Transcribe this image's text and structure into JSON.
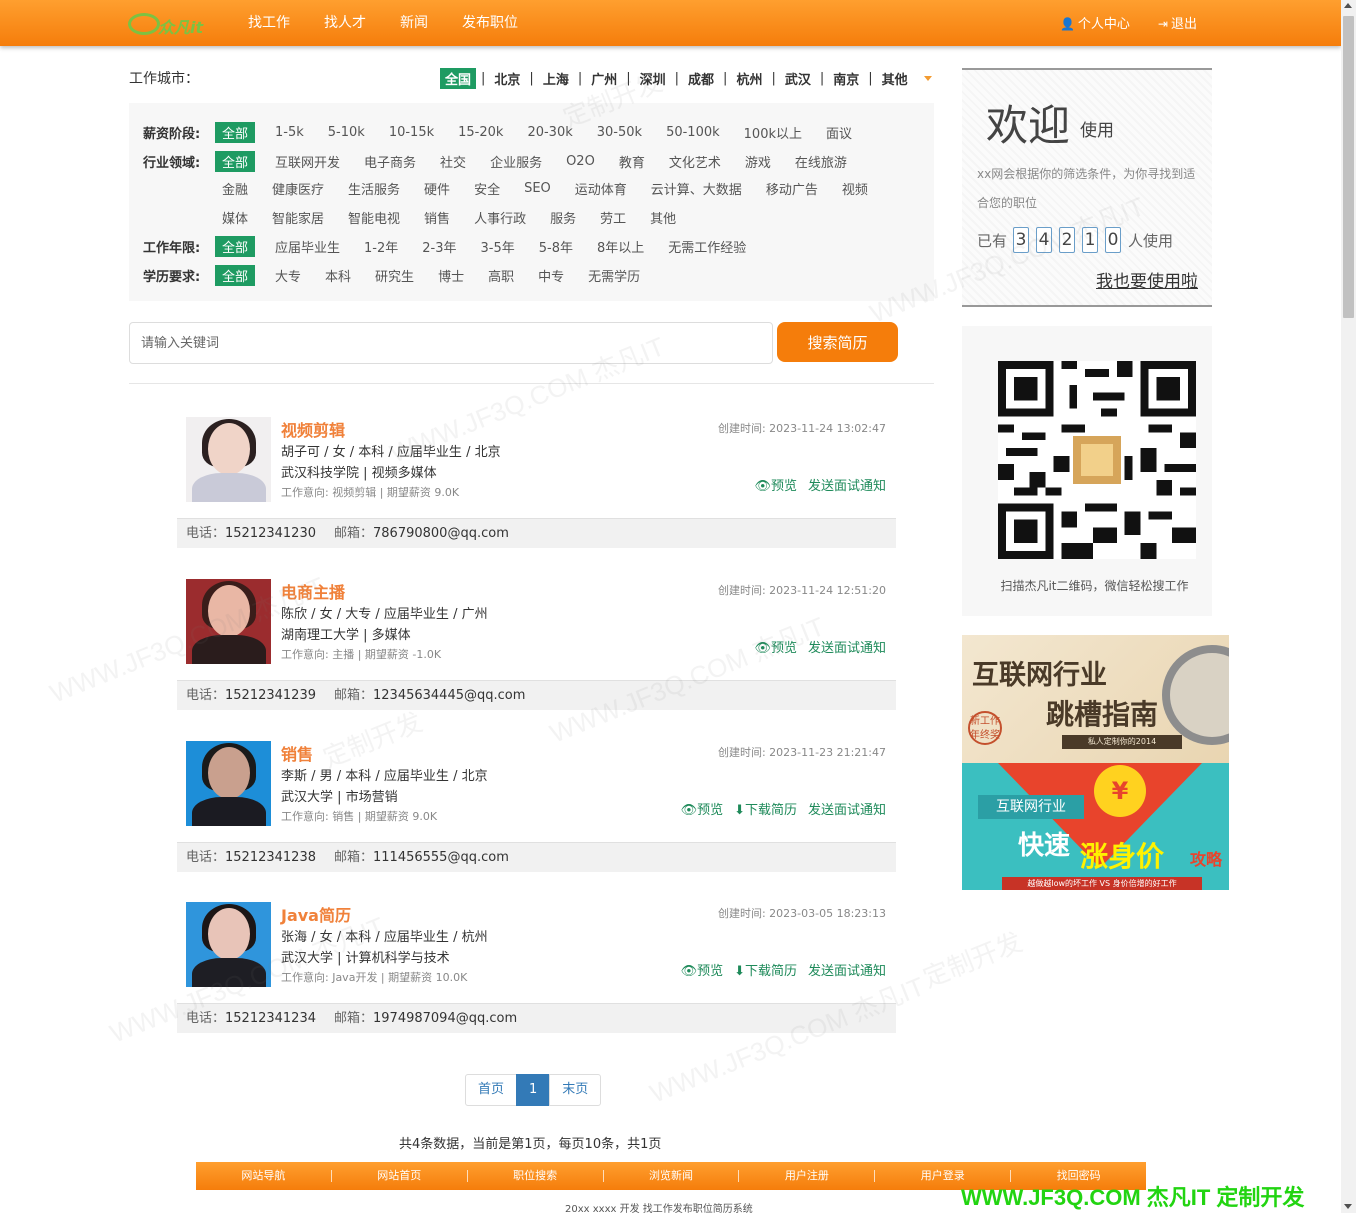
{
  "header": {
    "logo_text": "众凡it",
    "nav": [
      "找工作",
      "找人才",
      "新闻",
      "发布职位"
    ],
    "user_center": "个人中心",
    "logout": "退出"
  },
  "city": {
    "label": "工作城市：",
    "items": [
      "全国",
      "北京",
      "上海",
      "广州",
      "深圳",
      "成都",
      "杭州",
      "武汉",
      "南京",
      "其他"
    ],
    "selected": "全国"
  },
  "filters": {
    "salary": {
      "label": "薪资阶段:",
      "options": [
        "全部",
        "1-5k",
        "5-10k",
        "10-15k",
        "15-20k",
        "20-30k",
        "30-50k",
        "50-100k",
        "100k以上",
        "面议"
      ]
    },
    "industry": {
      "label": "行业领域:",
      "row1": [
        "全部",
        "互联网开发",
        "电子商务",
        "社交",
        "企业服务",
        "O2O",
        "教育",
        "文化艺术",
        "游戏",
        "在线旅游"
      ],
      "row2": [
        "金融",
        "健康医疗",
        "生活服务",
        "硬件",
        "安全",
        "SEO",
        "运动体育",
        "云计算、大数据",
        "移动广告",
        "视频"
      ],
      "row3": [
        "媒体",
        "智能家居",
        "智能电视",
        "销售",
        "人事行政",
        "服务",
        "劳工",
        "其他"
      ]
    },
    "experience": {
      "label": "工作年限:",
      "options": [
        "全部",
        "应届毕业生",
        "1-2年",
        "2-3年",
        "3-5年",
        "5-8年",
        "8年以上",
        "无需工作经验"
      ]
    },
    "education": {
      "label": "学历要求:",
      "options": [
        "全部",
        "大专",
        "本科",
        "研究生",
        "博士",
        "高职",
        "中专",
        "无需学历"
      ]
    }
  },
  "search": {
    "placeholder": "请输入关键词",
    "button": "搜索简历"
  },
  "resumes": [
    {
      "title": "视频剪辑",
      "meta": "胡子可 / 女 / 本科 / 应届毕业生 / 北京",
      "school": "武汉科技学院 | 视频多媒体",
      "intent": "工作意向:   视频剪辑 | 期望薪资 9.0K",
      "created": "创建时间:  2023-11-24 13:02:47",
      "phone_label": "电话：",
      "phone": "15212341230",
      "email_label": "邮箱：",
      "email": "786790800@qq.com",
      "actions": [
        "👁预览",
        "发送面试通知"
      ]
    },
    {
      "title": "电商主播",
      "meta": "陈欣 / 女 / 大专 / 应届毕业生 / 广州",
      "school": "湖南理工大学 | 多媒体",
      "intent": "工作意向:   主播 | 期望薪资 -1.0K",
      "created": "创建时间:  2023-11-24 12:51:20",
      "phone_label": "电话：",
      "phone": "15212341239",
      "email_label": "邮箱：",
      "email": "12345634445@qq.com",
      "actions": [
        "👁预览",
        "发送面试通知"
      ]
    },
    {
      "title": "销售",
      "meta": "李斯 / 男 / 本科 / 应届毕业生 / 北京",
      "school": "武汉大学 | 市场营销",
      "intent": "工作意向:   销售 | 期望薪资 9.0K",
      "created": "创建时间:  2023-11-23 21:21:47",
      "phone_label": "电话：",
      "phone": "15212341238",
      "email_label": "邮箱：",
      "email": "111456555@qq.com",
      "actions": [
        "👁预览",
        "⬇下载简历",
        "发送面试通知"
      ]
    },
    {
      "title": "Java简历",
      "meta": "张海 / 女 / 本科 / 应届毕业生 / 杭州",
      "school": "武汉大学 | 计算机科学与技术",
      "intent": "工作意向:   Java开发 | 期望薪资 10.0K",
      "created": "创建时间:  2023-03-05 18:23:13",
      "phone_label": "电话：",
      "phone": "15212341234",
      "email_label": "邮箱：",
      "email": "1974987094@qq.com",
      "actions": [
        "👁预览",
        "⬇下载简历",
        "发送面试通知"
      ]
    }
  ],
  "pager": {
    "first": "首页",
    "current": "1",
    "last": "末页",
    "info": "共4条数据，当前是第1页，每页10条，共1页"
  },
  "footer": {
    "links": [
      "网站导航",
      "网站首页",
      "职位搜索",
      "浏览新闻",
      "用户注册",
      "用户登录",
      "找回密码"
    ],
    "copyright": "20xx  xxxx  开发  找工作发布职位简历系统",
    "brand": "WWW.JF3Q.COM 杰凡IT  定制开发"
  },
  "sidebar": {
    "welcome_big": "欢迎",
    "welcome_small": "使用",
    "desc": "xx网会根据你的筛选条件，为你寻找到适合您的职位",
    "count_prefix": "已有",
    "digits": [
      "3",
      "4",
      "2",
      "1",
      "0"
    ],
    "count_suffix": "人使用",
    "cta": "我也要使用啦",
    "qr_caption": "扫描杰凡it二维码，微信轻松搜工作",
    "ad1": {
      "line1": "互联网行业",
      "line2": "跳槽指南",
      "seal": "新工作 年终奖",
      "ribbon": "私人定制你的2014"
    },
    "ad2": {
      "badge": "互联网行业",
      "t1": "快速",
      "t2": "涨身价",
      "t3": "攻略",
      "bottom": "越做越low的坏工作 VS 身价倍增的好工作",
      "coin": "¥"
    }
  },
  "watermark": {
    "a": "WWW.JF3Q.COM 杰凡IT",
    "b": "定制开发"
  }
}
